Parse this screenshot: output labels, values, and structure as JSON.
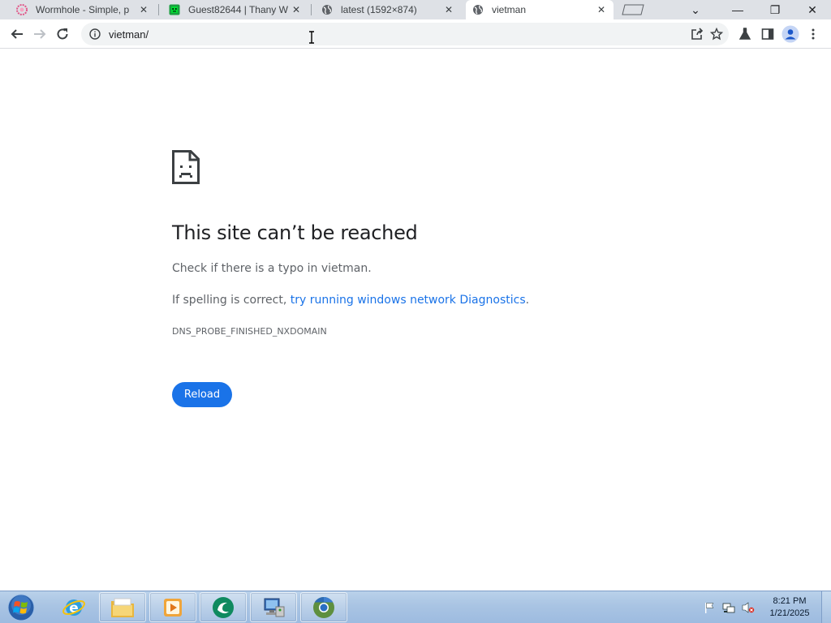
{
  "browser": {
    "tabs": [
      {
        "title": "Wormhole - Simple, p",
        "favicon": "wormhole-icon",
        "active": false
      },
      {
        "title": "Guest82644 | Thany W",
        "favicon": "green-face-icon",
        "active": false
      },
      {
        "title": "latest (1592×874)",
        "favicon": "globe-icon",
        "active": false
      },
      {
        "title": "vietman",
        "favicon": "globe-icon",
        "active": true
      }
    ],
    "close_glyph": "✕",
    "window_controls": {
      "tab_search": "⌄",
      "minimize": "—",
      "restore": "❐",
      "close": "✕"
    },
    "address": {
      "url": "vietman/",
      "info_icon": "info-icon"
    }
  },
  "page": {
    "error_title": "This site can’t be reached",
    "line1": "Check if there is a typo in vietman.",
    "line2_prefix": "If spelling is correct, ",
    "line2_link": "try running windows network Diagnostics",
    "line2_suffix": ".",
    "error_code": "DNS_PROBE_FINISHED_NXDOMAIN",
    "reload_label": "Reload"
  },
  "taskbar": {
    "time": "8:21 PM",
    "date": "1/21/2025",
    "items": [
      "internet-explorer-icon",
      "file-explorer-icon",
      "media-player-icon",
      "green-app-icon",
      "network-computer-icon",
      "chrome-icon"
    ]
  },
  "colors": {
    "accent": "#1a73e8",
    "title_text": "#202124",
    "body_text": "#5f6368",
    "tab_strip": "#dee1e6"
  }
}
